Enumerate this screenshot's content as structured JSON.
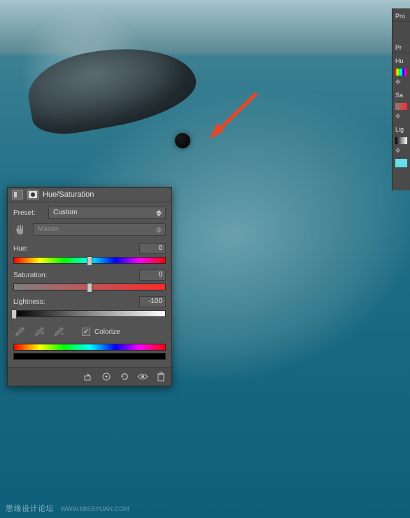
{
  "panel": {
    "title": "Hue/Saturation",
    "preset_label": "Preset:",
    "preset_value": "Custom",
    "channel_value": "Master",
    "hue_label": "Hue:",
    "hue_value": "0",
    "sat_label": "Saturation:",
    "sat_value": "0",
    "light_label": "Lightness:",
    "light_value": "-100",
    "colorize_label": "Colorize",
    "colorize_checked": "✓"
  },
  "right": {
    "section1": "Pro",
    "section2": "Pr",
    "hue": "Hu",
    "sat": "Sa",
    "light": "Lig"
  },
  "watermark": {
    "text": "思缘设计论坛",
    "url": "WWW.MISSYUAN.COM"
  },
  "colors": {
    "panel_bg": "#535353",
    "accent_arrow": "#e04a2b"
  }
}
